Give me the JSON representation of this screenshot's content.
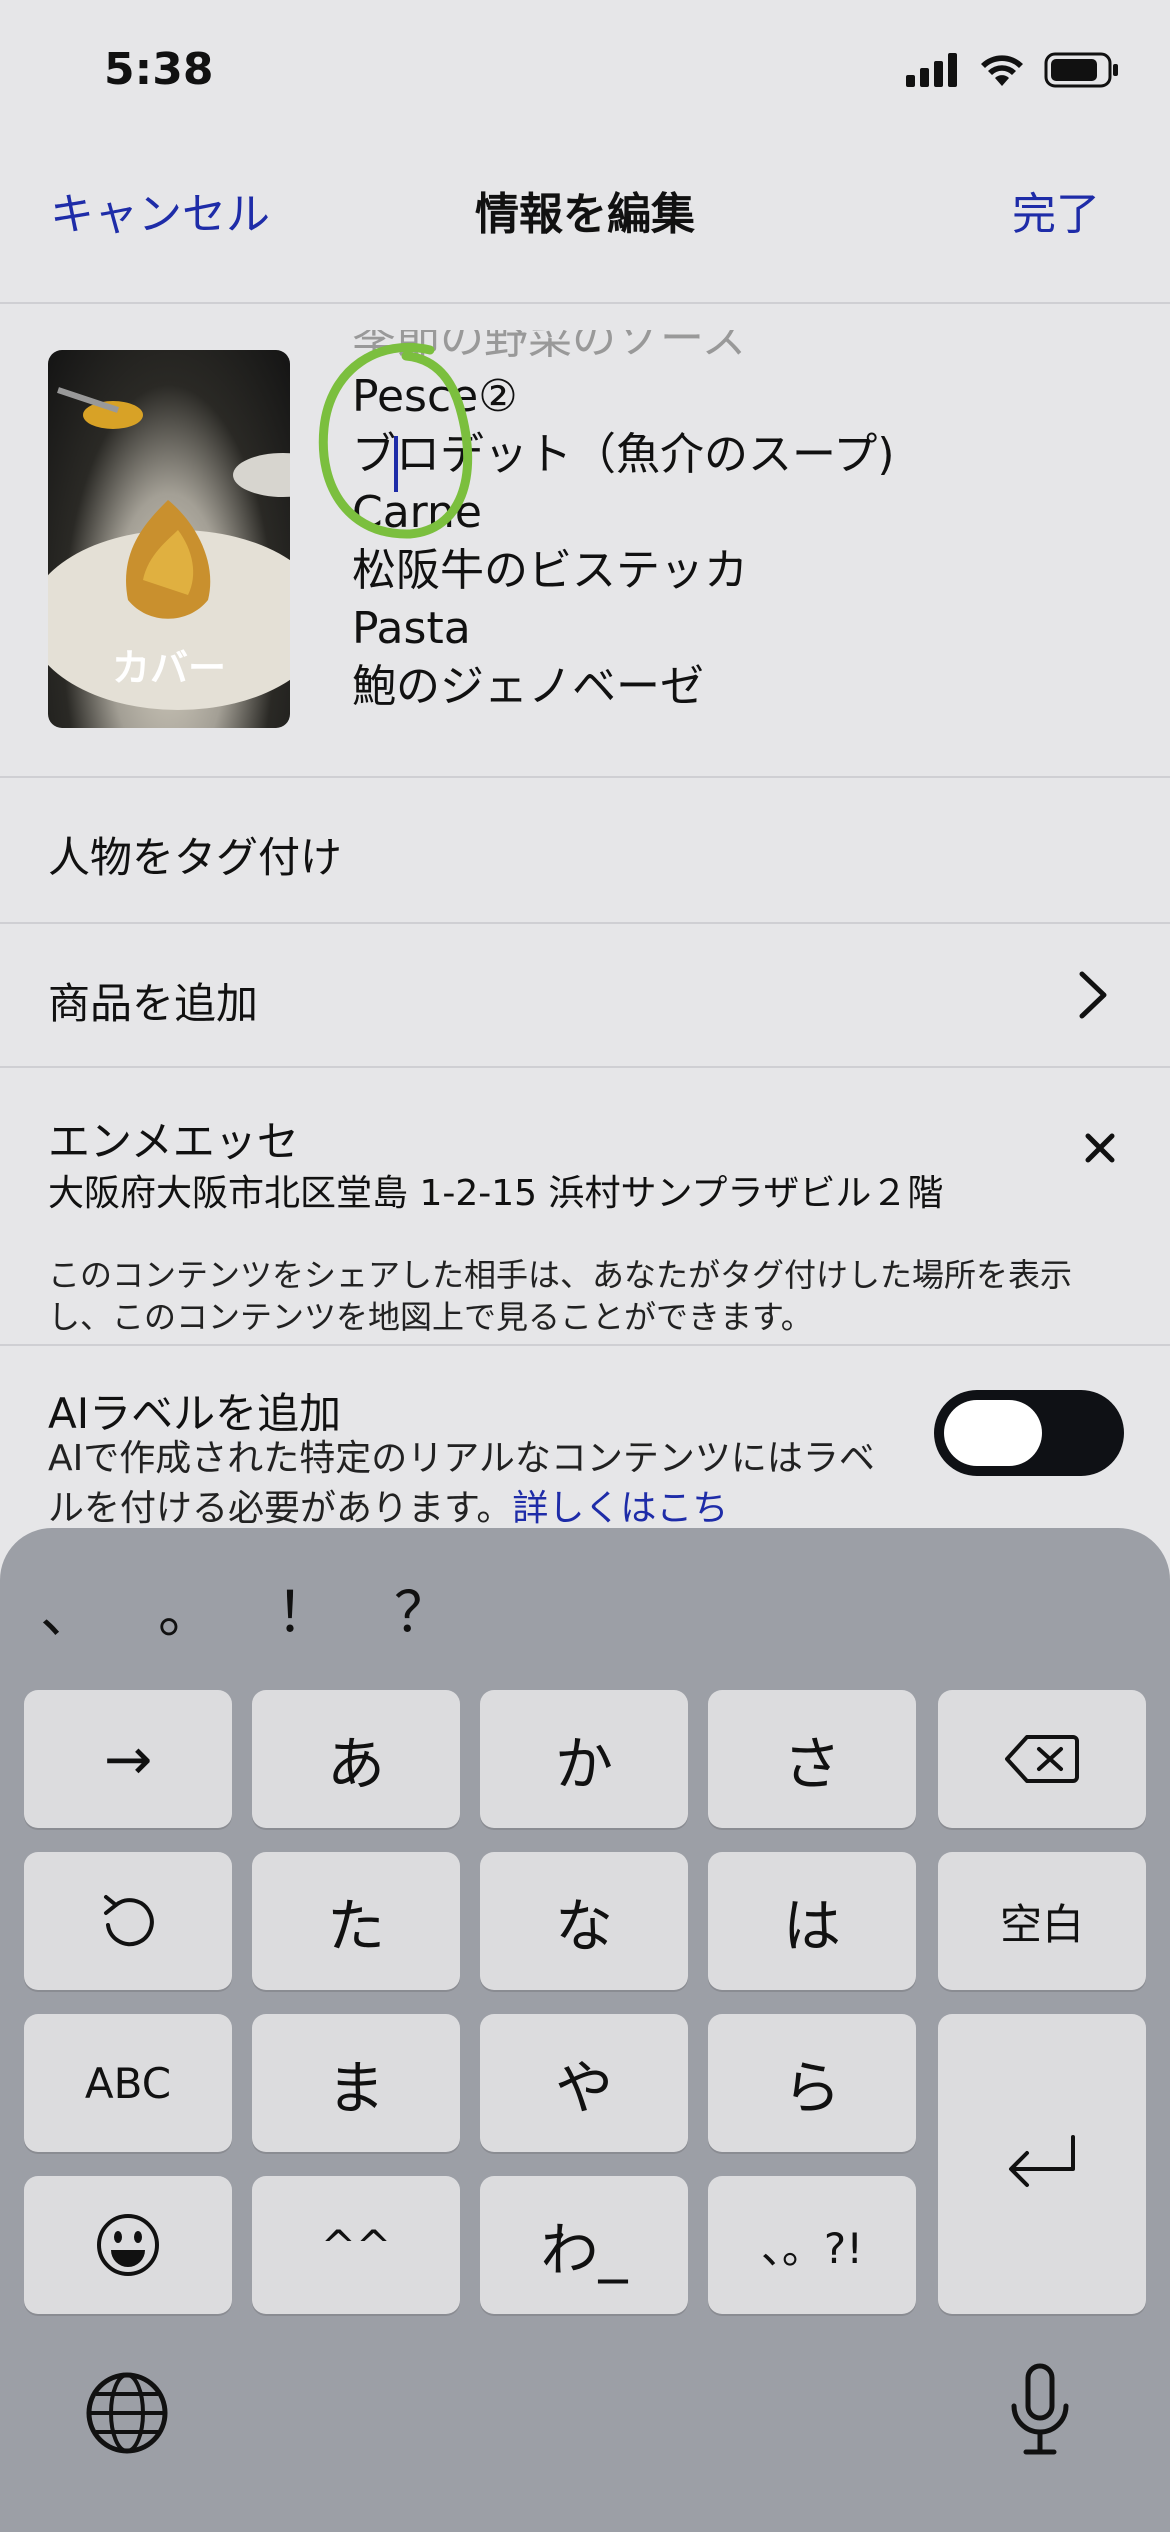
{
  "status_bar": {
    "time": "5:38"
  },
  "nav": {
    "cancel": "キャンセル",
    "title": "情報を編集",
    "done": "完了"
  },
  "cover": {
    "label": "カバー"
  },
  "caption": {
    "lines": [
      "季節の野菜のソース",
      "Pesce②",
      "ブロデット（魚介のスープ)",
      "Carne",
      "松阪牛のビステッカ",
      "Pasta",
      "鮑のジェノベーゼ"
    ]
  },
  "rows": {
    "tag_people": "人物をタグ付け",
    "add_products": "商品を追加"
  },
  "location": {
    "name": "エンメエッセ",
    "address": "大阪府大阪市北区堂島 1-2-15 浜村サンプラザビル２階",
    "note": "このコンテンツをシェアした相手は、あなたがタグ付けした場所を表示し、このコンテンツを地図上で見ることができます。"
  },
  "ai_label": {
    "title": "AIラベルを追加",
    "description": "AIで作成された特定のリアルなコンテンツにはラベルを付ける必要があります。",
    "link": "詳しくはこち",
    "enabled": false
  },
  "keyboard": {
    "punctuation": [
      "、",
      "。",
      "！",
      "？"
    ],
    "rows": [
      [
        "→",
        "あ",
        "か",
        "さ",
        "⌫"
      ],
      [
        "↺",
        "た",
        "な",
        "は",
        "空白"
      ],
      [
        "ABC",
        "ま",
        "や",
        "ら",
        "⏎"
      ],
      [
        "☺",
        "^^",
        "わ_",
        "、。?!"
      ]
    ],
    "icons": {
      "globe": "globe-icon",
      "mic": "microphone-icon"
    }
  }
}
